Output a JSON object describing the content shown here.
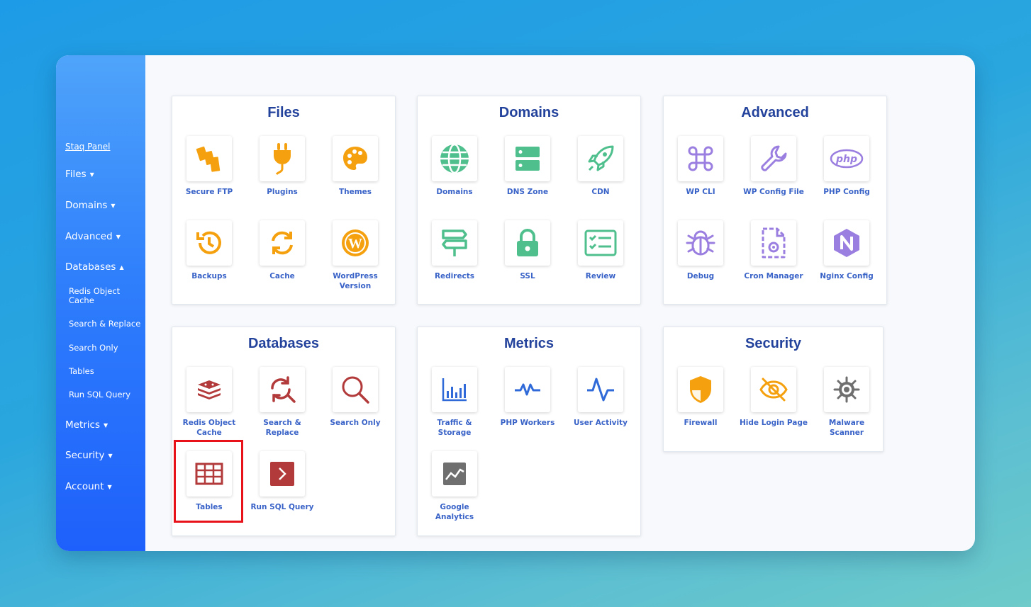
{
  "sidebar": {
    "panel_link": "Staq Panel",
    "items": [
      {
        "label": "Files",
        "caret": "▼"
      },
      {
        "label": "Domains",
        "caret": "▼"
      },
      {
        "label": "Advanced",
        "caret": "▼"
      },
      {
        "label": "Databases",
        "caret": "▲"
      },
      {
        "label": "Metrics",
        "caret": "▼"
      },
      {
        "label": "Security",
        "caret": "▼"
      },
      {
        "label": "Account",
        "caret": "▼"
      }
    ],
    "subitems": [
      "Redis Object Cache",
      "Search & Replace",
      "Search Only",
      "Tables",
      "Run SQL Query"
    ]
  },
  "cards": {
    "files": {
      "title": "Files",
      "tiles": [
        "Secure FTP",
        "Plugins",
        "Themes",
        "Backups",
        "Cache",
        "WordPress Version"
      ]
    },
    "domains": {
      "title": "Domains",
      "tiles": [
        "Domains",
        "DNS Zone",
        "CDN",
        "Redirects",
        "SSL",
        "Review"
      ]
    },
    "advanced": {
      "title": "Advanced",
      "tiles": [
        "WP CLI",
        "WP Config File",
        "PHP Config",
        "Debug",
        "Cron Manager",
        "Nginx Config"
      ]
    },
    "databases": {
      "title": "Databases",
      "tiles": [
        "Redis Object Cache",
        "Search & Replace",
        "Search Only",
        "Tables",
        "Run SQL Query"
      ]
    },
    "metrics": {
      "title": "Metrics",
      "tiles": [
        "Traffic & Storage",
        "PHP Workers",
        "User Activity",
        "Google Analytics"
      ]
    },
    "security": {
      "title": "Security",
      "tiles": [
        "Firewall",
        "Hide Login Page",
        "Malware Scanner"
      ]
    }
  },
  "colors": {
    "files_accent": "#f5a10f",
    "domains_accent": "#4fc08d",
    "advanced_accent": "#9b7fe0",
    "databases_accent": "#b23a3a",
    "metrics_accent": "#2f6ad8",
    "highlight": "#e8131a",
    "title": "#23429b"
  }
}
